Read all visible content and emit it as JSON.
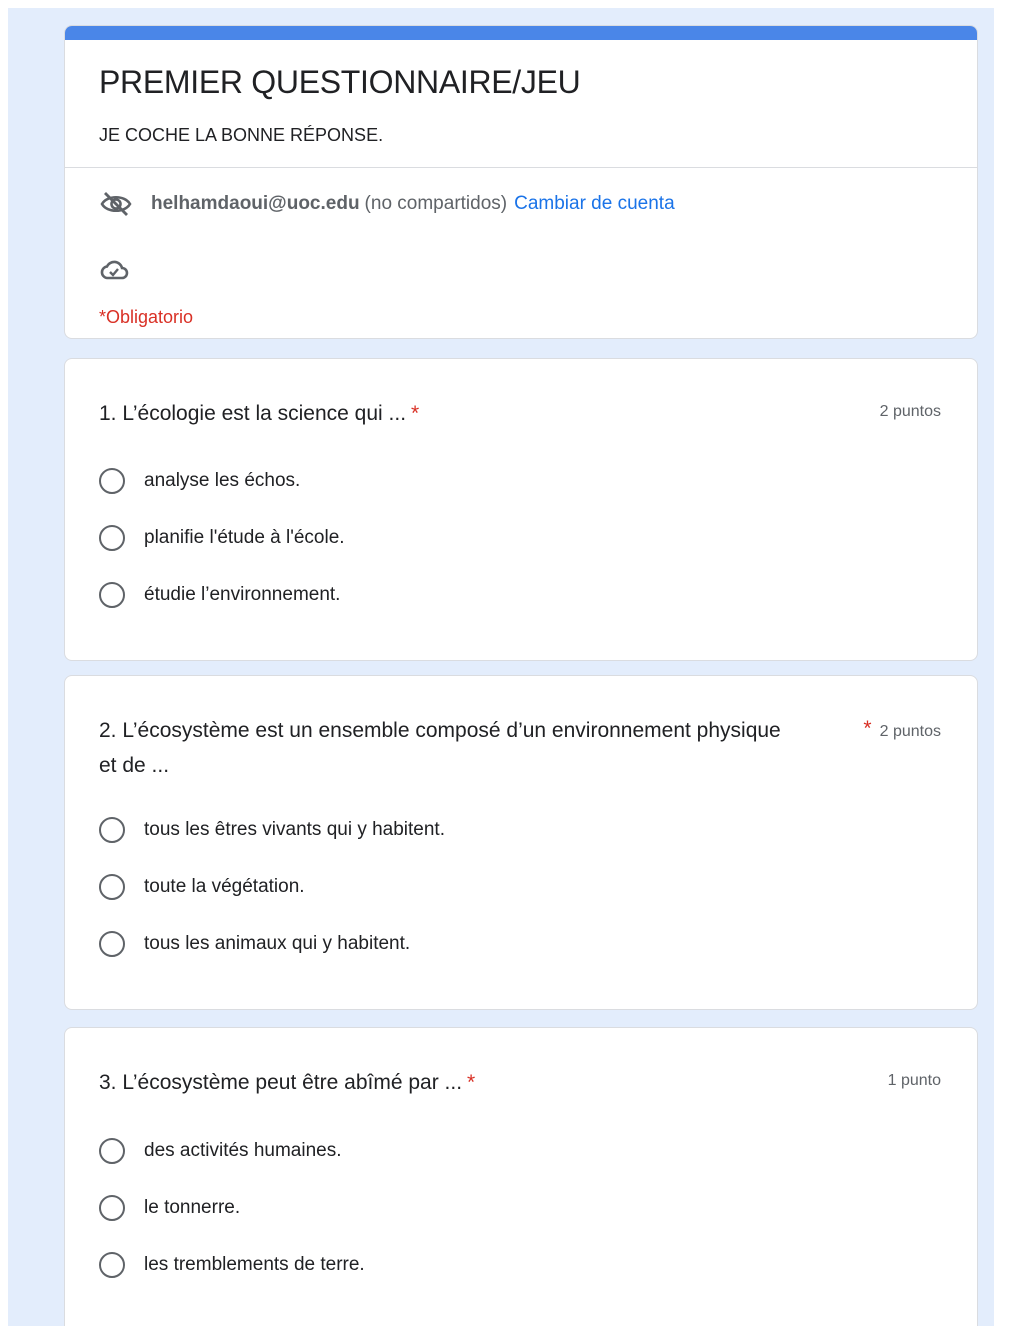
{
  "header": {
    "title": "PREMIER QUESTIONNAIRE/JEU",
    "description": "JE COCHE LA BONNE RÉPONSE.",
    "account_email": "helhamdaoui@uoc.edu",
    "not_shared": "(no compartidos)",
    "switch_account": "Cambiar de cuenta",
    "required_note": "*Obligatorio",
    "icons": [
      "eye-off-icon",
      "cloud-check-icon"
    ]
  },
  "colors": {
    "accent": "#4a86e8",
    "background": "#e3edfc",
    "required": "#d93025",
    "link": "#1a73e8"
  },
  "questions": [
    {
      "title": "1. L’écologie est la science qui ...",
      "required_mark": "*",
      "points": "2 puntos",
      "options": [
        "analyse les échos.",
        "planifie l'étude à l'école.",
        "étudie l’environnement."
      ]
    },
    {
      "title": "2. L’écosystème est un ensemble composé d’un environnement physique et de ...",
      "required_mark": "*",
      "points": "2 puntos",
      "options": [
        "tous les êtres vivants qui y habitent.",
        "toute la végétation.",
        "tous les animaux qui y habitent."
      ]
    },
    {
      "title": "3. L’écosystème peut être abîmé par ...",
      "required_mark": "*",
      "points": "1 punto",
      "options": [
        "des activités humaines.",
        "le tonnerre.",
        "les tremblements de terre."
      ]
    }
  ]
}
